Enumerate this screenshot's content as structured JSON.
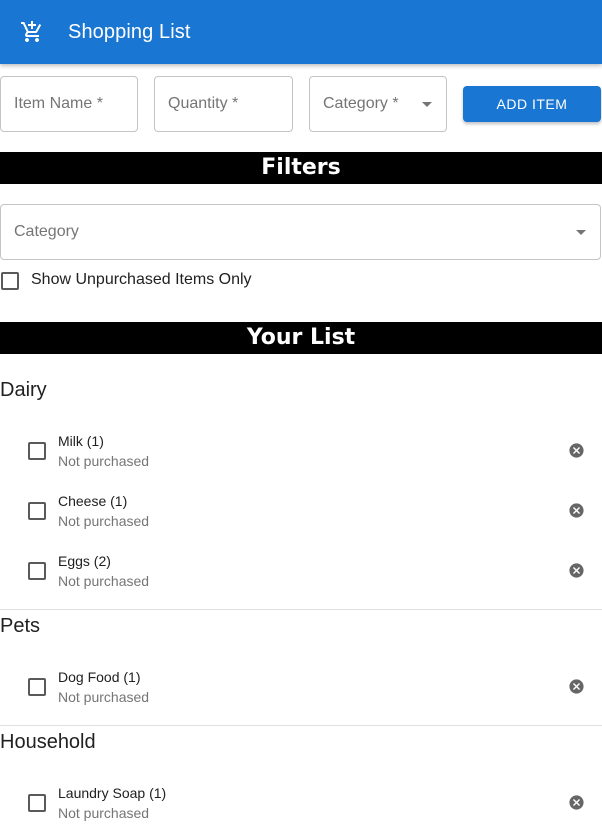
{
  "app": {
    "title": "Shopping List"
  },
  "form": {
    "item_name_placeholder": "Item Name *",
    "quantity_placeholder": "Quantity *",
    "category_placeholder": "Category *",
    "add_button": "ADD ITEM"
  },
  "filters": {
    "heading": "Filters",
    "category_placeholder": "Category",
    "unpurchased_label": "Show Unpurchased Items Only"
  },
  "list": {
    "heading": "Your List",
    "groups": [
      {
        "name": "Dairy",
        "items": [
          {
            "label": "Milk (1)",
            "status": "Not purchased"
          },
          {
            "label": "Cheese (1)",
            "status": "Not purchased"
          },
          {
            "label": "Eggs (2)",
            "status": "Not purchased"
          }
        ]
      },
      {
        "name": "Pets",
        "items": [
          {
            "label": "Dog Food (1)",
            "status": "Not purchased"
          }
        ]
      },
      {
        "name": "Household",
        "items": [
          {
            "label": "Laundry Soap (1)",
            "status": "Not purchased"
          }
        ]
      }
    ]
  },
  "icons": {
    "app": "cart-plus-icon",
    "delete": "cancel-icon",
    "dropdown": "arrow-drop-down-icon"
  },
  "colors": {
    "primary": "#1976d2",
    "section_bar": "#000000",
    "delete_icon": "#666666"
  }
}
